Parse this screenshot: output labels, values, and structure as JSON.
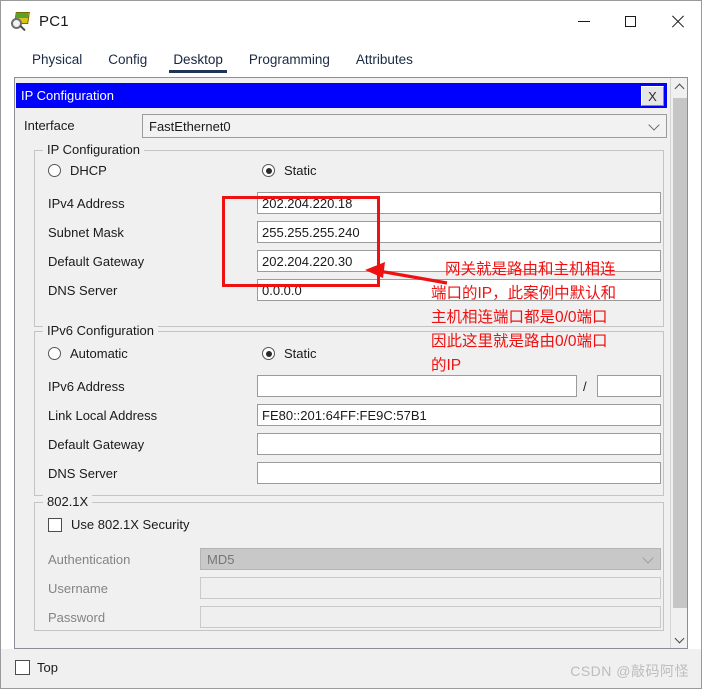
{
  "window": {
    "title": "PC1",
    "icon": "packet-tracer-pc-icon",
    "minimize_label": "—",
    "maximize_label": "□",
    "close_label": "✕"
  },
  "tabs": [
    {
      "label": "Physical",
      "active": false
    },
    {
      "label": "Config",
      "active": false
    },
    {
      "label": "Desktop",
      "active": true
    },
    {
      "label": "Programming",
      "active": false
    },
    {
      "label": "Attributes",
      "active": false
    }
  ],
  "panel": {
    "title": "IP Configuration",
    "close_label": "X"
  },
  "interface": {
    "label": "Interface",
    "value": "FastEthernet0"
  },
  "ipv4": {
    "legend": "IP Configuration",
    "mode_dhcp": "DHCP",
    "mode_static": "Static",
    "selected_mode": "Static",
    "fields": [
      {
        "label": "IPv4 Address",
        "value": "202.204.220.18"
      },
      {
        "label": "Subnet Mask",
        "value": "255.255.255.240"
      },
      {
        "label": "Default Gateway",
        "value": "202.204.220.30"
      },
      {
        "label": "DNS Server",
        "value": "0.0.0.0"
      }
    ]
  },
  "ipv6": {
    "legend": "IPv6 Configuration",
    "mode_automatic": "Automatic",
    "mode_static": "Static",
    "selected_mode": "Static",
    "prefix_separator": "/",
    "prefix_value": "",
    "fields": [
      {
        "label": "IPv6 Address",
        "value": ""
      },
      {
        "label": "Link Local Address",
        "value": "FE80::201:64FF:FE9C:57B1"
      },
      {
        "label": "Default Gateway",
        "value": ""
      },
      {
        "label": "DNS Server",
        "value": ""
      }
    ]
  },
  "dot1x": {
    "legend": "802.1X",
    "use_security_label": "Use 802.1X Security",
    "use_security_checked": false,
    "auth_label": "Authentication",
    "auth_value": "MD5",
    "username_label": "Username",
    "username_value": "",
    "password_label": "Password",
    "password_value": ""
  },
  "bottom": {
    "top_label": "Top",
    "top_checked": false,
    "watermark": "CSDN @敲码阿怪"
  },
  "annotation": {
    "color": "#ee1111",
    "line1": "网关就是路由和主机相连",
    "line2": "端口的IP，此案例中默认和",
    "line3": "主机相连端口都是0/0端口",
    "line4": "因此这里就是路由0/0端口",
    "line5": "的IP"
  }
}
